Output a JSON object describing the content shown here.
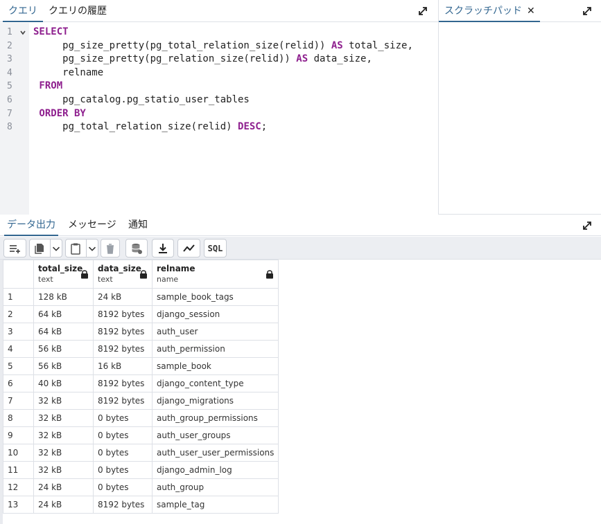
{
  "query_panel": {
    "tabs": [
      "クエリ",
      "クエリの履歴"
    ],
    "active_tab": 0
  },
  "scratch_panel": {
    "tab_label": "スクラッチパッド",
    "close_glyph": "✕"
  },
  "editor": {
    "line_numbers": [
      "1",
      "2",
      "3",
      "4",
      "5",
      "6",
      "7",
      "8"
    ],
    "lines": [
      {
        "kw1": "SELECT",
        "text": "",
        "kw2": "",
        "text2": ""
      },
      {
        "kw1": "",
        "text": "     pg_size_pretty(pg_total_relation_size(relid)) ",
        "kw2": "AS",
        "text2": " total_size,"
      },
      {
        "kw1": "",
        "text": "     pg_size_pretty(pg_relation_size(relid)) ",
        "kw2": "AS",
        "text2": " data_size,"
      },
      {
        "kw1": "",
        "text": "     relname",
        "kw2": "",
        "text2": ""
      },
      {
        "kw1": " FROM",
        "text": "",
        "kw2": "",
        "text2": ""
      },
      {
        "kw1": "",
        "text": "     pg_catalog.pg_statio_user_tables",
        "kw2": "",
        "text2": ""
      },
      {
        "kw1": " ORDER BY",
        "text": "",
        "kw2": "",
        "text2": ""
      },
      {
        "kw1": "",
        "text": "     pg_total_relation_size(relid) ",
        "kw2": "DESC",
        "text2": ";"
      }
    ]
  },
  "results": {
    "tabs": [
      "データ出力",
      "メッセージ",
      "通知"
    ],
    "active_tab": 0,
    "toolbar": {
      "sql_label": "SQL"
    },
    "columns": [
      {
        "name": "total_size",
        "type": "text",
        "locked": true
      },
      {
        "name": "data_size",
        "type": "text",
        "locked": true
      },
      {
        "name": "relname",
        "type": "name",
        "locked": true
      }
    ],
    "rows": [
      [
        "1",
        "128 kB",
        "24 kB",
        "sample_book_tags"
      ],
      [
        "2",
        "64 kB",
        "8192 bytes",
        "django_session"
      ],
      [
        "3",
        "64 kB",
        "8192 bytes",
        "auth_user"
      ],
      [
        "4",
        "56 kB",
        "8192 bytes",
        "auth_permission"
      ],
      [
        "5",
        "56 kB",
        "16 kB",
        "sample_book"
      ],
      [
        "6",
        "40 kB",
        "8192 bytes",
        "django_content_type"
      ],
      [
        "7",
        "32 kB",
        "8192 bytes",
        "django_migrations"
      ],
      [
        "8",
        "32 kB",
        "0 bytes",
        "auth_group_permissions"
      ],
      [
        "9",
        "32 kB",
        "0 bytes",
        "auth_user_groups"
      ],
      [
        "10",
        "32 kB",
        "0 bytes",
        "auth_user_user_permissions"
      ],
      [
        "11",
        "32 kB",
        "0 bytes",
        "django_admin_log"
      ],
      [
        "12",
        "24 kB",
        "0 bytes",
        "auth_group"
      ],
      [
        "13",
        "24 kB",
        "8192 bytes",
        "sample_tag"
      ]
    ]
  },
  "colors": {
    "accent": "#326690",
    "keyword": "#8e1f8e"
  }
}
